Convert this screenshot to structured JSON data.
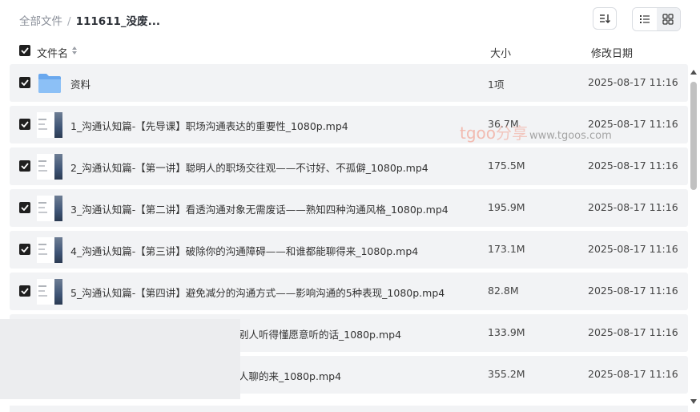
{
  "breadcrumb": {
    "root": "全部文件",
    "separator": "/",
    "current": "111611_没废..."
  },
  "toolbar": {
    "sort_icon": "sort-icon",
    "list_view_icon": "list-view-icon",
    "grid_view_icon": "grid-view-icon"
  },
  "columns": {
    "name": "文件名",
    "size": "大小",
    "date": "修改日期"
  },
  "files": [
    {
      "name": "资料",
      "size": "1项",
      "date": "2025-08-17 11:16",
      "type": "folder"
    },
    {
      "name": "1_沟通认知篇-【先导课】职场沟通表达的重要性_1080p.mp4",
      "size": "36.7M",
      "date": "2025-08-17 11:16",
      "type": "video"
    },
    {
      "name": "2_沟通认知篇-【第一讲】聪明人的职场交往观——不讨好、不孤僻_1080p.mp4",
      "size": "175.5M",
      "date": "2025-08-17 11:16",
      "type": "video"
    },
    {
      "name": "3_沟通认知篇-【第二讲】看透沟通对象无需废话——熟知四种沟通风格_1080p.mp4",
      "size": "195.9M",
      "date": "2025-08-17 11:16",
      "type": "video"
    },
    {
      "name": "4_沟通认知篇-【第三讲】破除你的沟通障碍——和谁都能聊得来_1080p.mp4",
      "size": "173.1M",
      "date": "2025-08-17 11:16",
      "type": "video"
    },
    {
      "name": "5_沟通认知篇-【第四讲】避免减分的沟通方式——影响沟通的5种表现_1080p.mp4",
      "size": "82.8M",
      "date": "2025-08-17 11:16",
      "type": "video"
    },
    {
      "name": "别人听得懂愿意听的话_1080p.mp4",
      "size": "133.9M",
      "date": "2025-08-17 11:16",
      "type": "video"
    },
    {
      "name": "人聊的来_1080p.mp4",
      "size": "355.2M",
      "date": "2025-08-17 11:16",
      "type": "video"
    }
  ],
  "watermark": {
    "brand": "tgoo",
    "brand_cn": "分享",
    "url": "www.tgoos.com"
  },
  "colors": {
    "row_bg": "#f2f3f5",
    "checkbox": "#1f1f1f",
    "folder": "#7cb4f2"
  }
}
